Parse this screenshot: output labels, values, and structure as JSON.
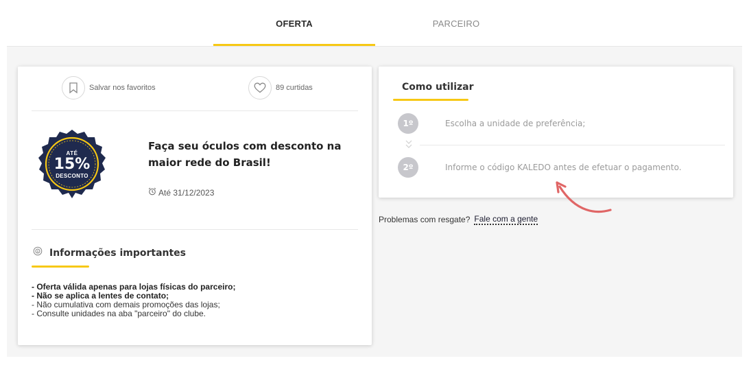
{
  "tabs": [
    {
      "label": "OFERTA",
      "active": true
    },
    {
      "label": "PARCEIRO",
      "active": false
    }
  ],
  "offer_card": {
    "favorite_label": "Salvar nos favoritos",
    "likes_label": "89 curtidas",
    "badge": {
      "top": "ATÉ",
      "percent": "15%",
      "bottom": "DESCONTO"
    },
    "title": "Faça seu óculos com desconto na maior rede do Brasil!",
    "date_label": "Até 31/12/2023",
    "info_title": "Informações importantes",
    "info_items": [
      {
        "text": "- Oferta válida apenas para lojas físicas do parceiro;",
        "bold": true
      },
      {
        "text": "- Não se aplica a lentes de contato;",
        "bold": true
      },
      {
        "text": "- Não cumulativa com demais promoções das lojas;",
        "bold": false
      },
      {
        "text": "- Consulte unidades na aba \"parceiro\" do clube.",
        "bold": false
      }
    ]
  },
  "how_to": {
    "title": "Como utilizar",
    "steps": [
      {
        "num": "1º",
        "text": "Escolha a unidade de preferência;"
      },
      {
        "num": "2º",
        "text": "Informe o código KALEDO antes de efetuar o pagamento."
      }
    ]
  },
  "problems": {
    "text": "Problemas com resgate?",
    "link": "Fale com a gente"
  },
  "colors": {
    "accent": "#f7c814",
    "badge_bg": "#1f2a4e",
    "arrow": "#e06666"
  },
  "icons": [
    "bookmark-icon",
    "heart-icon",
    "alarm-clock-icon",
    "info-circle-icon",
    "chevron-double-down-icon",
    "curved-arrow-icon"
  ]
}
